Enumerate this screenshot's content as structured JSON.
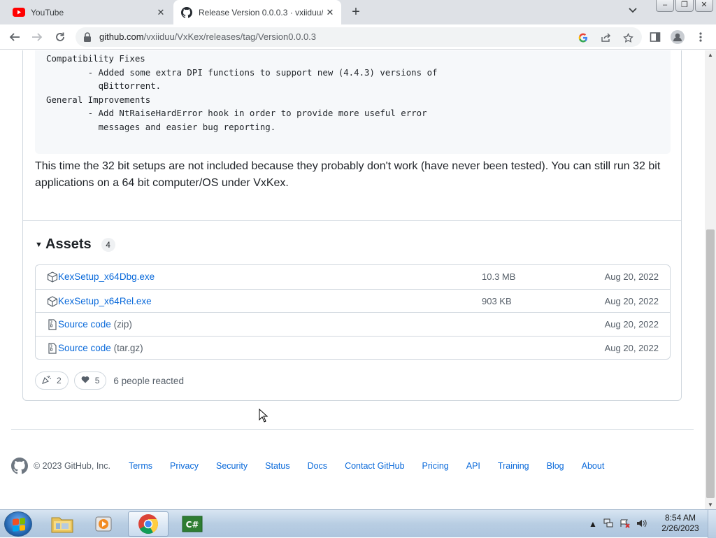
{
  "browser": {
    "tabs": [
      {
        "title": "YouTube",
        "icon": "youtube-icon",
        "active": false
      },
      {
        "title": "Release Version 0.0.0.3 · vxiiduu/",
        "icon": "github-icon",
        "active": true
      }
    ],
    "new_tab": "+",
    "url_host": "github.com",
    "url_path": "/vxiiduu/VxKex/releases/tag/Version0.0.0.3"
  },
  "release": {
    "code_text": "Compatibility Fixes\n        - Added some extra DPI functions to support new (4.4.3) versions of\n          qBittorrent.\nGeneral Improvements\n        - Add NtRaiseHardError hook in order to provide more useful error\n          messages and easier bug reporting.",
    "note": "This time the 32 bit setups are not included because they probably don't work (have never been tested). You can still run 32 bit applications on a 64 bit computer/OS under VxKex.",
    "assets_title": "Assets",
    "assets_count": "4",
    "assets": [
      {
        "name": "KexSetup_x64Dbg.exe",
        "ext": "",
        "size": "10.3 MB",
        "date": "Aug 20, 2022",
        "icon": "package-icon"
      },
      {
        "name": "KexSetup_x64Rel.exe",
        "ext": "",
        "size": "903 KB",
        "date": "Aug 20, 2022",
        "icon": "package-icon"
      },
      {
        "name": "Source code",
        "ext": "(zip)",
        "size": "",
        "date": "Aug 20, 2022",
        "icon": "file-zip-icon"
      },
      {
        "name": "Source code",
        "ext": "(tar.gz)",
        "size": "",
        "date": "Aug 20, 2022",
        "icon": "file-zip-icon"
      }
    ],
    "reactions": [
      {
        "emoji": "tada",
        "count": "2"
      },
      {
        "emoji": "heart",
        "count": "5"
      }
    ],
    "reactions_text": "6 people reacted"
  },
  "footer": {
    "copyright": "© 2023 GitHub, Inc.",
    "links": [
      "Terms",
      "Privacy",
      "Security",
      "Status",
      "Docs",
      "Contact GitHub",
      "Pricing",
      "API",
      "Training",
      "Blog",
      "About"
    ]
  },
  "taskbar": {
    "apps": [
      "explorer",
      "media-player",
      "chrome",
      "csharp-app"
    ],
    "time": "8:54 AM",
    "date": "2/26/2023"
  },
  "colors": {
    "link": "#0969da",
    "muted": "#57606a",
    "border": "#d0d7de"
  }
}
